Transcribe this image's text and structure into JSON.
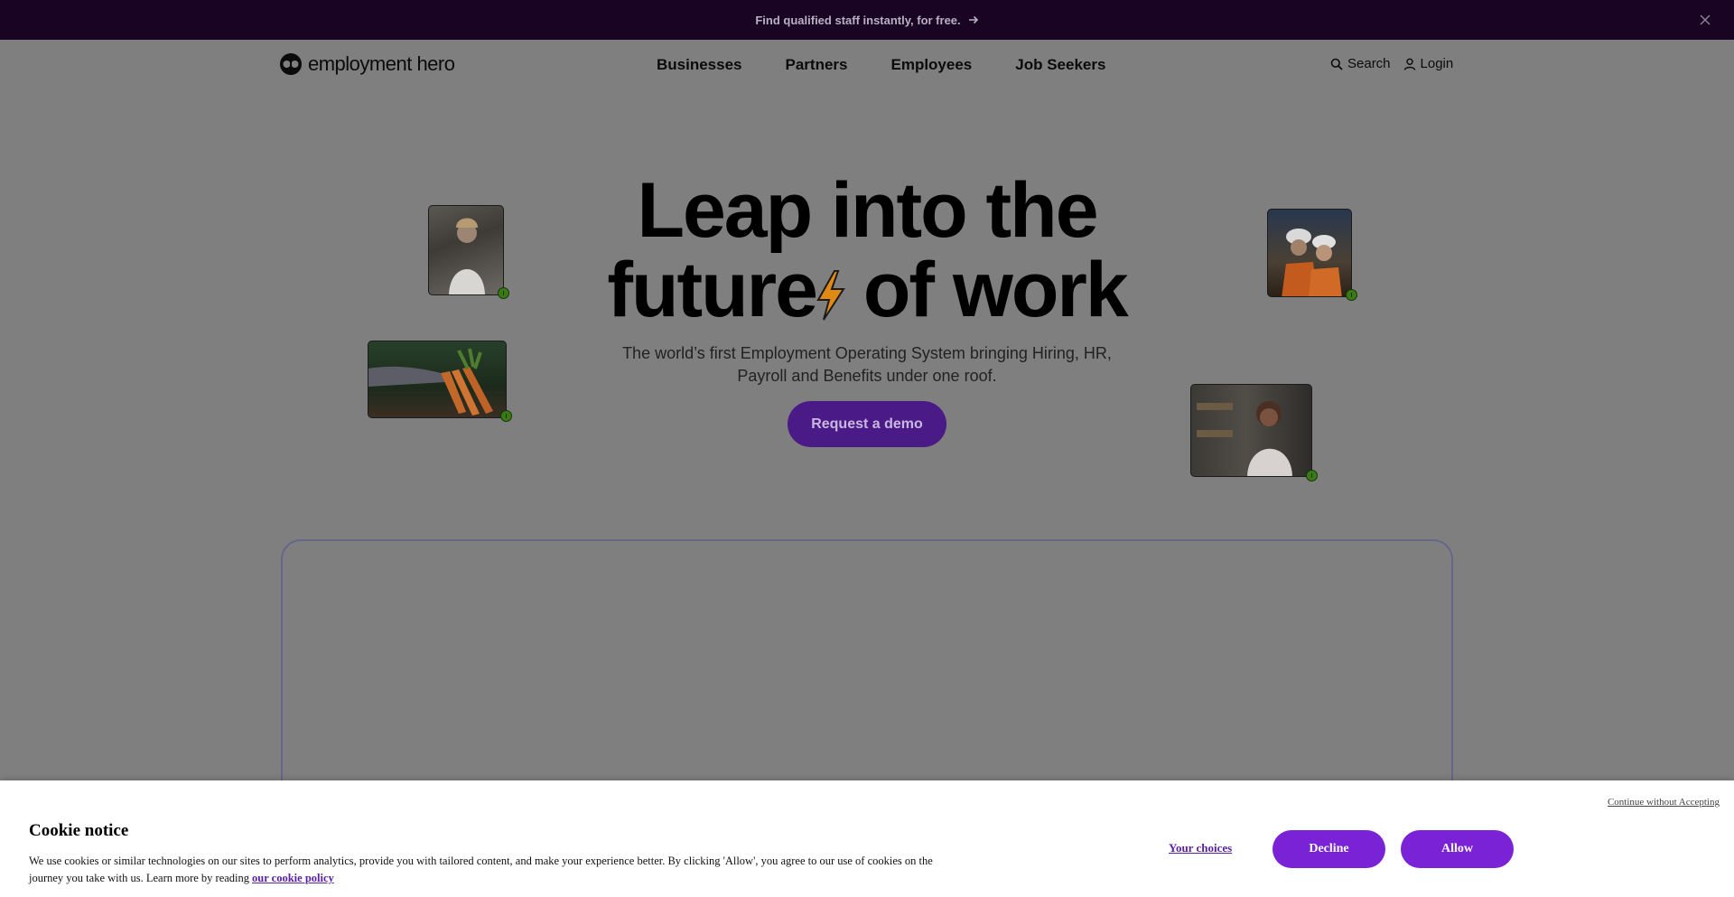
{
  "announcement": {
    "text": "Find qualified staff instantly, for free.",
    "arrow_icon": "arrow-right-icon",
    "close_icon": "close-icon"
  },
  "nav": {
    "logo_text": "employment hero",
    "links": [
      "Businesses",
      "Partners",
      "Employees",
      "Job Seekers"
    ],
    "search_label": "Search",
    "login_label": "Login"
  },
  "hero": {
    "title_line1": "Leap into the",
    "title_line2_a": "futur",
    "title_line2_b": "e",
    "title_line2_c": "of work",
    "subtitle": "The world’s first Employment Operating System bringing Hiring, HR, Payroll and Benefits under one roof.",
    "cta_label": "Request a demo"
  },
  "cookie": {
    "continue_label": "Continue without Accepting",
    "title": "Cookie notice",
    "body": "We use cookies or similar technologies on our sites to perform analytics, provide you with tailored content, and make your experience better. By clicking 'Allow', you agree to our use of cookies on the journey you take with us. Learn more by reading",
    "policy_link": "our cookie policy",
    "your_choices_label": "Your choices",
    "decline_label": "Decline",
    "allow_label": "Allow"
  },
  "colors": {
    "topbar": "#1a0424",
    "cta": "#4a1b86",
    "cookie_button": "#7a22d6",
    "backdrop": "#7f7f7f"
  }
}
